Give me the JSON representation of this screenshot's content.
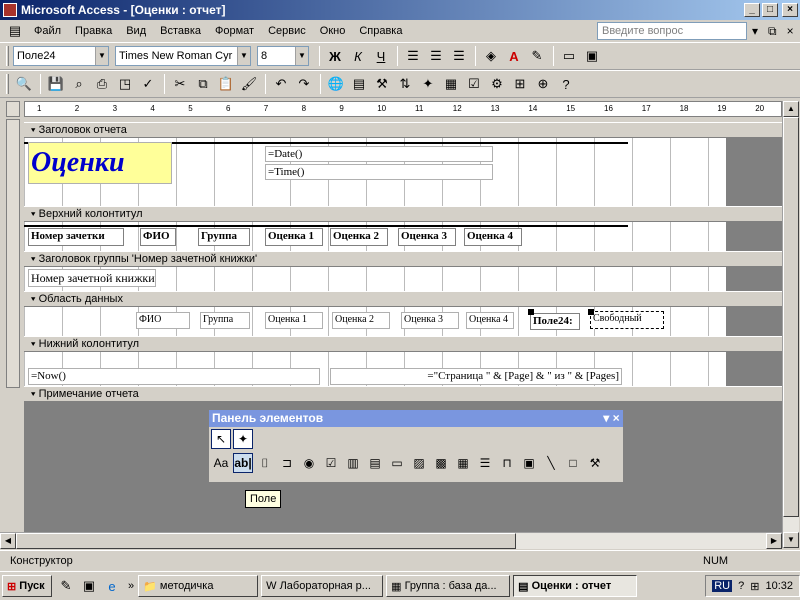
{
  "window": {
    "title": "Microsoft Access - [Оценки : отчет]",
    "min": "_",
    "max": "□",
    "close": "×"
  },
  "menu": [
    "Файл",
    "Правка",
    "Вид",
    "Вставка",
    "Формат",
    "Сервис",
    "Окно",
    "Справка"
  ],
  "ask_placeholder": "Введите вопрос",
  "format_bar": {
    "object": "Поле24",
    "font": "Times New Roman Cyr",
    "size": "8"
  },
  "sections": {
    "report_header": "Заголовок отчета",
    "page_header": "Верхний колонтитул",
    "group_header": "Заголовок группы 'Номер зачетной книжки'",
    "detail": "Область данных",
    "page_footer": "Нижний колонтитул",
    "report_footer": "Примечание отчета"
  },
  "report_header": {
    "title": "Оценки",
    "date": "=Date()",
    "time": "=Time()"
  },
  "page_header": [
    "Номер зачетки",
    "ФИО",
    "Группа",
    "Оценка 1",
    "Оценка 2",
    "Оценка 3",
    "Оценка 4"
  ],
  "group_header": {
    "field": "Номер зачетной книжки"
  },
  "detail": {
    "fields": [
      "ФИО",
      "Группа",
      "Оценка 1",
      "Оценка 2",
      "Оценка 3",
      "Оценка 4"
    ],
    "label": "Поле24:",
    "free": "Свободный"
  },
  "page_footer": {
    "now": "=Now()",
    "page": "=\"Страница \" & [Page] & \" из \" & [Pages]"
  },
  "ruler": [
    "1",
    "2",
    "3",
    "4",
    "5",
    "6",
    "7",
    "8",
    "9",
    "10",
    "11",
    "12",
    "13",
    "14",
    "15",
    "16",
    "17",
    "18",
    "19",
    "20"
  ],
  "toolbox": {
    "title": "Панель элементов",
    "tooltip": "Поле"
  },
  "status": {
    "mode": "Конструктор",
    "num": "NUM"
  },
  "taskbar": {
    "start": "Пуск",
    "tasks": [
      "методичка",
      "Лабораторная р...",
      "Группа : база да...",
      "Оценки : отчет"
    ],
    "lang": "RU",
    "time": "10:32"
  }
}
